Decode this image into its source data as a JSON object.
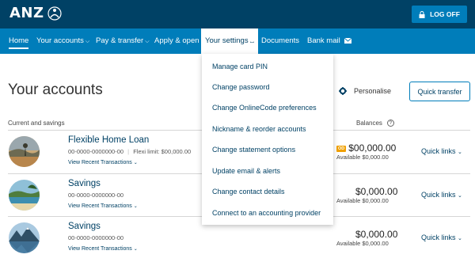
{
  "header": {
    "logo_text": "ANZ",
    "logoff_label": "LOG OFF"
  },
  "nav": {
    "items": [
      {
        "label": "Home"
      },
      {
        "label": "Your accounts"
      },
      {
        "label": "Pay & transfer"
      },
      {
        "label": "Apply & open"
      },
      {
        "label": "Your settings"
      },
      {
        "label": "Documents"
      },
      {
        "label": "Bank mail"
      }
    ]
  },
  "main": {
    "title": "Your accounts",
    "personalise_label": "Personalise",
    "quick_transfer_label": "Quick transfer",
    "section_label": "Current and savings",
    "balances_label": "Balances"
  },
  "accounts": [
    {
      "name": "Flexible Home Loan",
      "number": "00-0000-0000000-00",
      "extra": "Flexi limit: $00,000.00",
      "link": "View Recent Transactions",
      "badge": "OD",
      "balance": "$00,000.00",
      "available": "Available $0,000.00",
      "quick_links": "Quick links"
    },
    {
      "name": "Savings",
      "number": "00-0000-0000000-00",
      "extra": "",
      "link": "View Recent Transactions",
      "badge": "",
      "balance": "$0,000.00",
      "available": "Available $0,000.00",
      "quick_links": "Quick links"
    },
    {
      "name": "Savings",
      "number": "00-0000-0000000-00",
      "extra": "",
      "link": "View Recent Transactions",
      "badge": "",
      "balance": "$0,000.00",
      "available": "Available $0,000.00",
      "quick_links": "Quick links"
    }
  ],
  "settings_menu": {
    "items": [
      "Manage card PIN",
      "Change password",
      "Change OnlineCode preferences",
      "Nickname & reorder accounts",
      "Change statement options",
      "Update email & alerts",
      "Change contact details",
      "Connect to an accounting provider"
    ]
  },
  "colors": {
    "header_bg": "#004165",
    "nav_bg": "#007dba",
    "link": "#004165",
    "badge": "#f0a000"
  }
}
